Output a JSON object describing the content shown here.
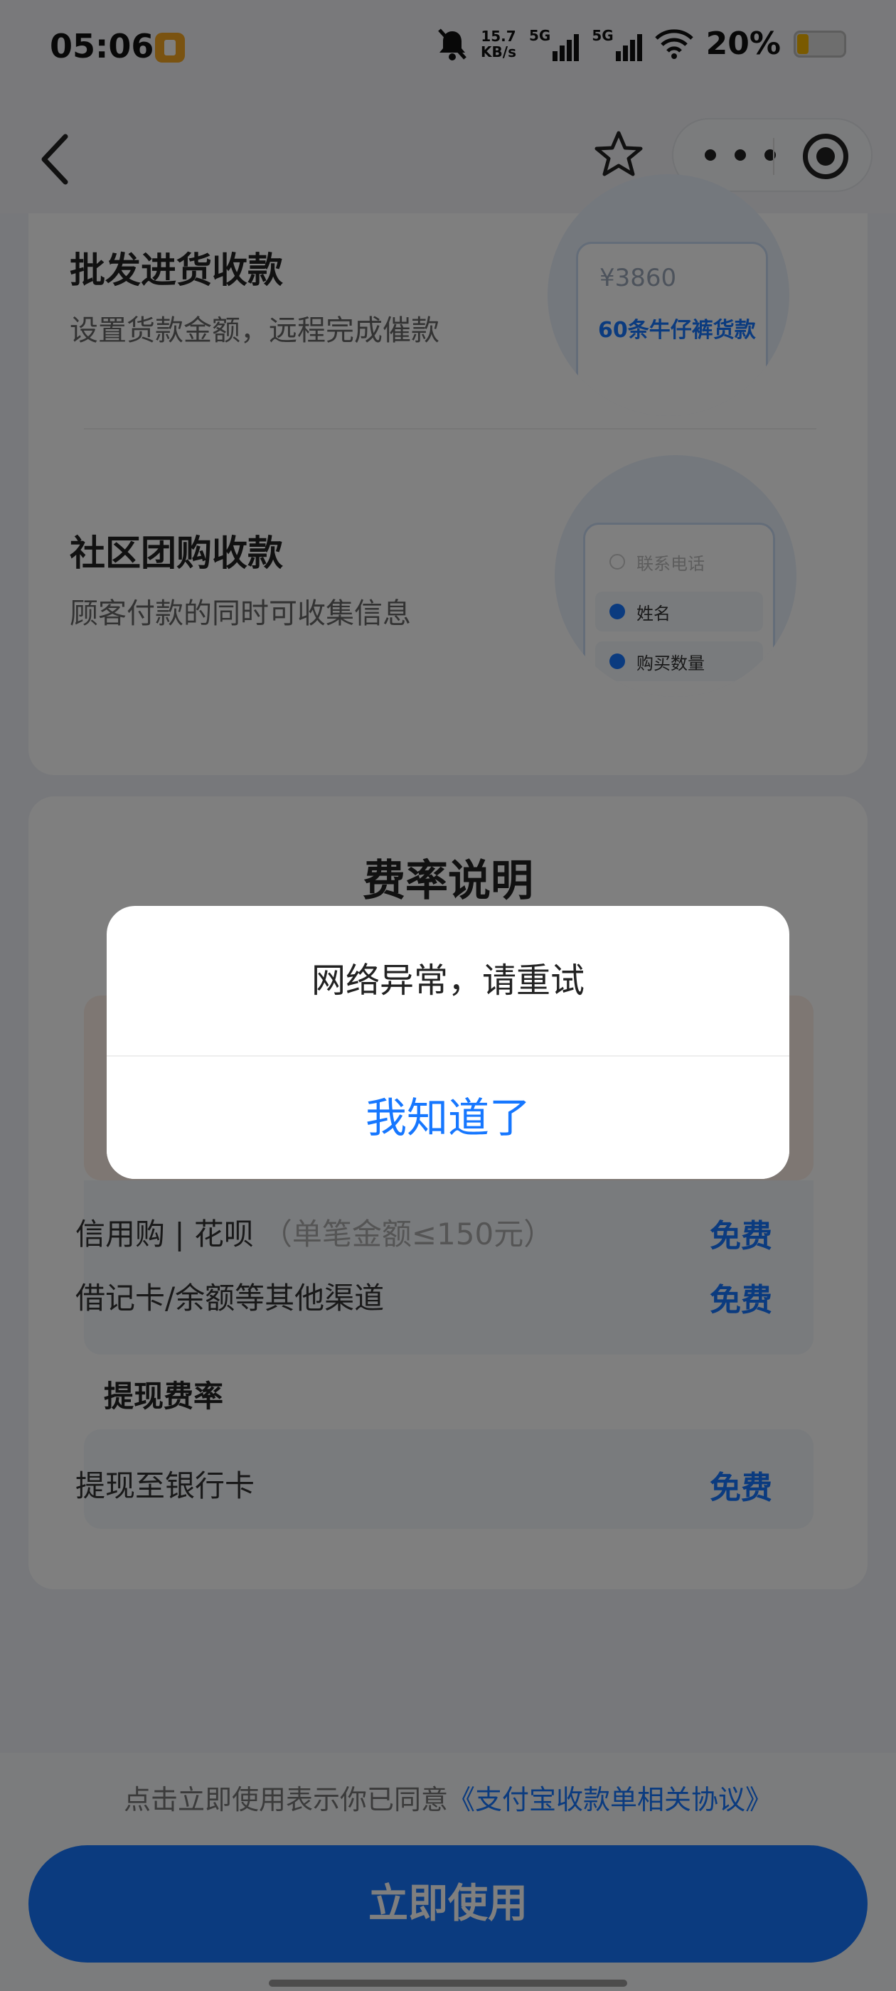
{
  "status_bar": {
    "time": "05:06",
    "net_speed_value": "15.7",
    "net_speed_unit": "KB/s",
    "signal1": "5G",
    "signal2": "5G",
    "battery": "20%"
  },
  "nav": {
    "back_icon": "chevron-left-icon",
    "favorite_icon": "star-icon",
    "more_icon": "more-dots-icon",
    "close_icon": "target-icon"
  },
  "features": [
    {
      "title": "批发进货收款",
      "desc": "设置货款金额，远程完成催款",
      "illustration": {
        "price": "¥3860",
        "label": "60条牛仔裤货款"
      }
    },
    {
      "title": "社区团购收款",
      "desc": "顾客付款的同时可收集信息",
      "illustration": {
        "rows": [
          "联系电话",
          "姓名",
          "购买数量"
        ]
      }
    }
  ],
  "rates": {
    "title": "费率说明",
    "rows": [
      {
        "label": "信用购 | 花呗",
        "hint": "（单笔金额≤150元）",
        "value": "免费"
      },
      {
        "label": "借记卡/余额等其他渠道",
        "value": "免费"
      }
    ],
    "withdraw_title": "提现费率",
    "withdraw": {
      "label": "提现至银行卡",
      "value": "免费"
    }
  },
  "footer": {
    "agree_prefix": "点击立即使用表示你已同意",
    "agree_link": "《支付宝收款单相关协议》",
    "button": "立即使用"
  },
  "dialog": {
    "message": "网络异常，请重试",
    "confirm": "我知道了"
  },
  "colors": {
    "accent": "#1677ff",
    "mask": "rgba(0,0,0,0.5)"
  }
}
